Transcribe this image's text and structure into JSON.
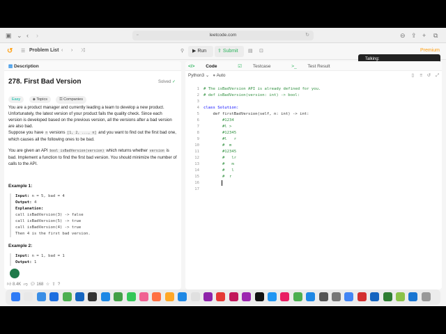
{
  "browser": {
    "url": "leetcode.com"
  },
  "toolbar": {
    "problem_list": "Problem List",
    "run_label": "Run",
    "submit_label": "Submit",
    "premium": "Premium"
  },
  "overlay": {
    "talking": "Talking:"
  },
  "left": {
    "tab": "Description",
    "title": "278. First Bad Version",
    "solved": "Solved",
    "tags": [
      "Easy",
      "Topics",
      "Companies"
    ],
    "para1": "You are a product manager and currently leading a team to develop a new product. Unfortunately, the latest version of your product fails the quality check. Since each version is developed based on the previous version, all the versions after a bad version are also bad.",
    "para2_a": "Suppose you have ",
    "para2_code1": "n",
    "para2_b": " versions ",
    "para2_code2": "[1, 2, ..., n]",
    "para2_c": " and you want to find out the first bad one, which causes all the following ones to be bad.",
    "para3_a": "You are given an API ",
    "para3_code1": "bool isBadVersion(version)",
    "para3_b": " which returns whether ",
    "para3_code2": "version",
    "para3_c": " is bad. Implement a function to find the first bad version. You should minimize the number of calls to the API.",
    "example1": {
      "title": "Example 1:",
      "input_label": "Input:",
      "input": " n = 5, bad = 4",
      "output_label": "Output:",
      "output": " 4",
      "expl_label": "Explanation:",
      "lines": [
        "call isBadVersion(3) -> false",
        "call isBadVersion(5) -> true",
        "call isBadVersion(4) -> true",
        "Then 4 is the first bad version."
      ]
    },
    "example2": {
      "title": "Example 2:",
      "input_label": "Input:",
      "input": " n = 1, bad = 1",
      "output_label": "Output:",
      "output": " 1"
    },
    "footer": {
      "likes": "8.4K",
      "comments": "168"
    }
  },
  "right": {
    "tabs": [
      "Code",
      "Testcase",
      "Test Result"
    ],
    "language": "Python3",
    "mode": "Auto",
    "code": [
      {
        "n": "1",
        "t": "# The isBadVersion API is already defined for you.",
        "c": "cm"
      },
      {
        "n": "2",
        "t": "# def isBadVersion(version: int) -> bool:",
        "c": "cm"
      },
      {
        "n": "3",
        "t": "",
        "c": "tx"
      },
      {
        "n": "4",
        "t": "class Solution:",
        "c": "kw"
      },
      {
        "n": "5",
        "t": "    def firstBadVersion(self, n: int) -> int:",
        "c": "tx"
      },
      {
        "n": "6",
        "t": "        #1234",
        "c": "cm"
      },
      {
        "n": "7",
        "t": "        #l >",
        "c": "cm"
      },
      {
        "n": "8",
        "t": "        #12345",
        "c": "cm"
      },
      {
        "n": "9",
        "t": "        #l   r",
        "c": "cm"
      },
      {
        "n": "10",
        "t": "        #  m",
        "c": "cm"
      },
      {
        "n": "11",
        "t": "        #12345",
        "c": "cm"
      },
      {
        "n": "12",
        "t": "        #   lr",
        "c": "cm"
      },
      {
        "n": "13",
        "t": "        #   m",
        "c": "cm"
      },
      {
        "n": "14",
        "t": "        #   l",
        "c": "cm"
      },
      {
        "n": "15",
        "t": "        #  r",
        "c": "cm"
      },
      {
        "n": "16",
        "t": "        ",
        "c": "tx"
      },
      {
        "n": "17",
        "t": "",
        "c": "tx"
      }
    ]
  }
}
